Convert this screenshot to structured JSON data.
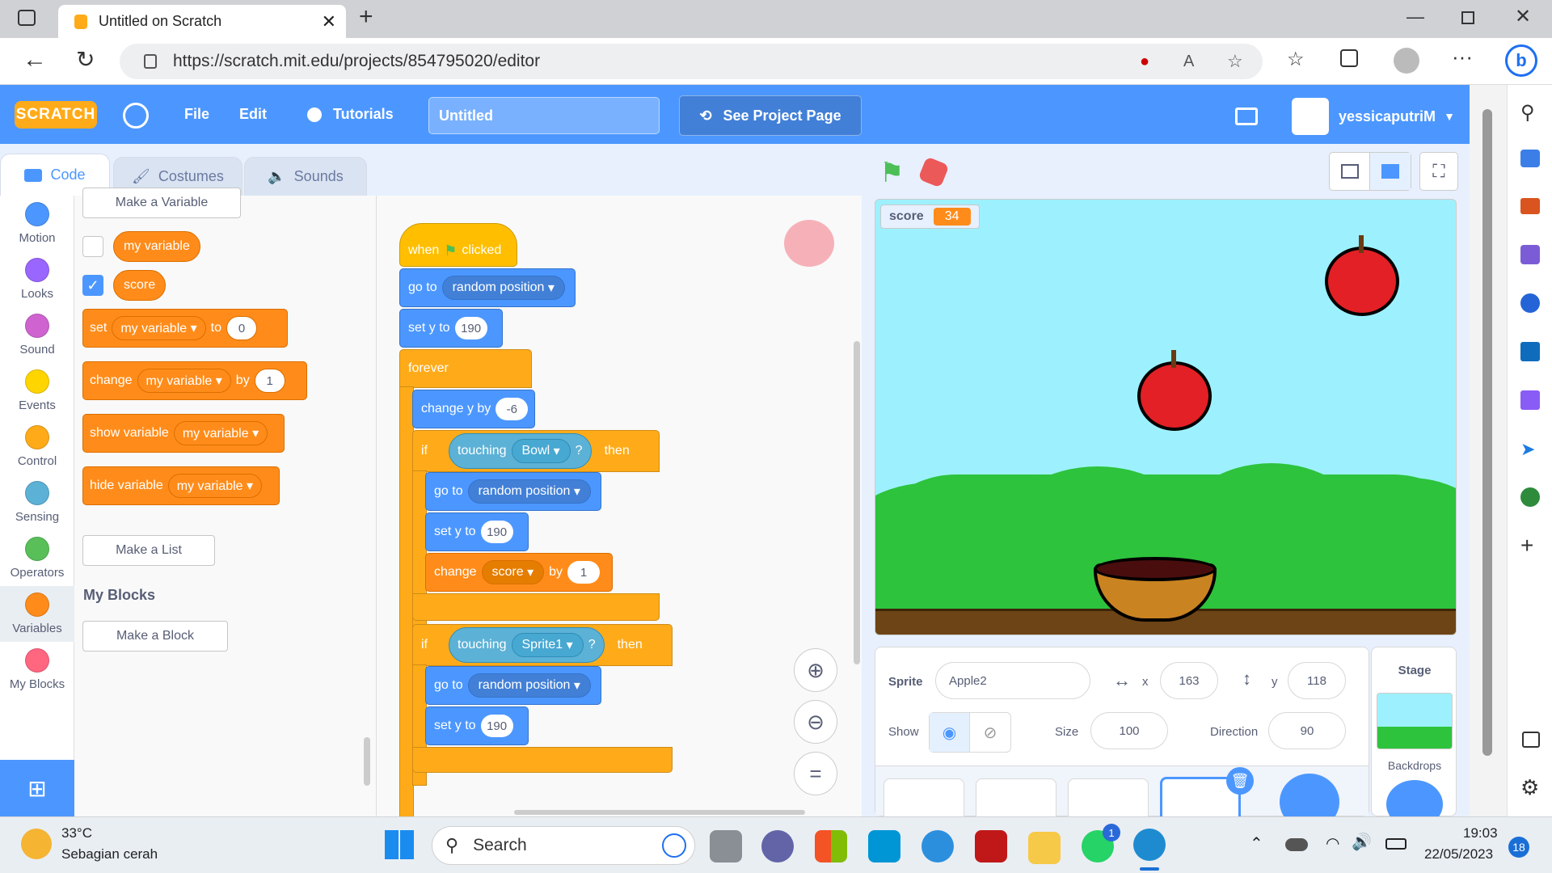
{
  "browser": {
    "tab_title": "Untitled on Scratch",
    "url": "https://scratch.mit.edu/projects/854795020/editor"
  },
  "menu": {
    "logo": "SCRATCH",
    "file": "File",
    "edit": "Edit",
    "tutorials": "Tutorials",
    "project_title": "Untitled",
    "see_project_page": "See Project Page",
    "username": "yessicaputriM"
  },
  "tabs": {
    "code": "Code",
    "costumes": "Costumes",
    "sounds": "Sounds"
  },
  "categories": [
    {
      "label": "Motion",
      "color": "#4c97ff"
    },
    {
      "label": "Looks",
      "color": "#9966ff"
    },
    {
      "label": "Sound",
      "color": "#cf63cf"
    },
    {
      "label": "Events",
      "color": "#ffd500"
    },
    {
      "label": "Control",
      "color": "#ffab19"
    },
    {
      "label": "Sensing",
      "color": "#5cb1d6"
    },
    {
      "label": "Operators",
      "color": "#59c059"
    },
    {
      "label": "Variables",
      "color": "#ff8c1a"
    },
    {
      "label": "My Blocks",
      "color": "#ff6680"
    }
  ],
  "palette": {
    "make_variable": "Make a Variable",
    "var1": "my variable",
    "var2": "score",
    "set_label": "set",
    "set_var": "my variable",
    "set_to": "to",
    "set_value": "0",
    "change_label": "change",
    "change_var": "my variable",
    "change_by": "by",
    "change_value": "1",
    "show_label": "show variable",
    "show_var": "my variable",
    "hide_label": "hide variable",
    "hide_var": "my variable",
    "make_list": "Make a List",
    "my_blocks_heading": "My Blocks",
    "make_block": "Make a Block"
  },
  "script": {
    "when": "when",
    "clicked": "clicked",
    "goto1": "go to",
    "goto1_target": "random position",
    "sety1": "set y to",
    "sety1_val": "190",
    "forever": "forever",
    "changey": "change y by",
    "changey_val": "-6",
    "if1": "if",
    "touching1": "touching",
    "touching1_target": "Bowl",
    "q1": "?",
    "then1": "then",
    "goto2": "go to",
    "goto2_target": "random position",
    "sety2": "set y to",
    "sety2_val": "190",
    "change": "change",
    "change_var": "score",
    "change_by": "by",
    "change_val": "1",
    "if2": "if",
    "touching2": "touching",
    "touching2_target": "Sprite1",
    "q2": "?",
    "then2": "then",
    "goto3": "go to",
    "goto3_target": "random position",
    "sety3": "set y to",
    "sety3_val": "190"
  },
  "stage": {
    "monitor_label": "score",
    "monitor_value": "34"
  },
  "sprite_info": {
    "sprite_label": "Sprite",
    "sprite_name": "Apple2",
    "x_label": "x",
    "x": "163",
    "y_label": "y",
    "y": "118",
    "show_label": "Show",
    "size_label": "Size",
    "size": "100",
    "direction_label": "Direction",
    "direction": "90"
  },
  "stage_panel": {
    "title": "Stage",
    "backdrops": "Backdrops"
  },
  "taskbar": {
    "weather_temp": "33°C",
    "weather_desc": "Sebagian cerah",
    "search": "Search",
    "time": "19:03",
    "date": "22/05/2023",
    "notif_count": "18",
    "whatsapp_badge": "1"
  }
}
